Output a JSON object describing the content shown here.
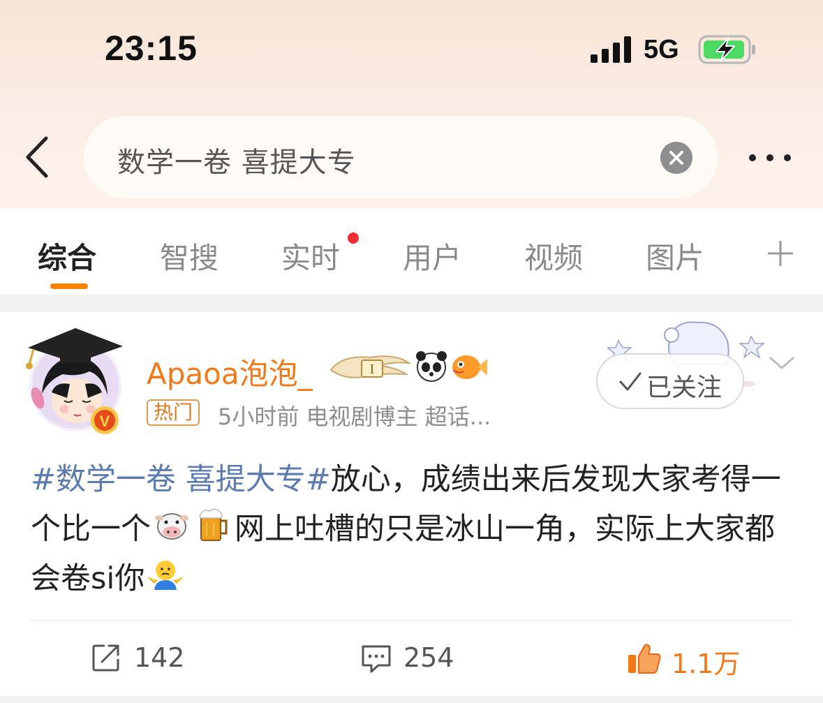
{
  "status_bar": {
    "time": "23:15",
    "network": "5G",
    "icons": [
      "signal-icon",
      "battery-charging-icon"
    ]
  },
  "header": {
    "search_query": "数学一卷 喜提大专",
    "icons": [
      "back-arrow-icon",
      "clear-search-icon",
      "more-icon"
    ]
  },
  "tabs": {
    "items": [
      {
        "label": "综合",
        "active": true
      },
      {
        "label": "智搜",
        "active": false
      },
      {
        "label": "实时",
        "active": false,
        "has_red_dot": true
      },
      {
        "label": "用户",
        "active": false
      },
      {
        "label": "视频",
        "active": false
      },
      {
        "label": "图片",
        "active": false
      }
    ],
    "add_icon": "plus-icon",
    "accent_color": "#ff8200"
  },
  "post": {
    "author": {
      "name": "Apaoa泡泡_",
      "verified_badge": "V",
      "badge_icons": [
        "level-badge-icon",
        "panda-icon",
        "fish-icon"
      ]
    },
    "hot_tag": "热门",
    "meta": "5小时前 电视剧博主 超话...",
    "follow_label": "已关注",
    "topic": "#数学一卷 喜提大专#",
    "text_1": "放心，成绩出来后发现大家考得一个比一个",
    "text_2": "网上吐槽的只是冰山一角，实际上大家都会卷si你",
    "emojis": [
      "cow-emoji",
      "beer-emoji",
      "shrug-emoji"
    ],
    "actions": {
      "repost_count": "142",
      "comment_count": "254",
      "like_count": "1.1万"
    },
    "colors": {
      "username": "#f07a1a",
      "topic": "#5b7bae",
      "like": "#f07a1a"
    }
  }
}
